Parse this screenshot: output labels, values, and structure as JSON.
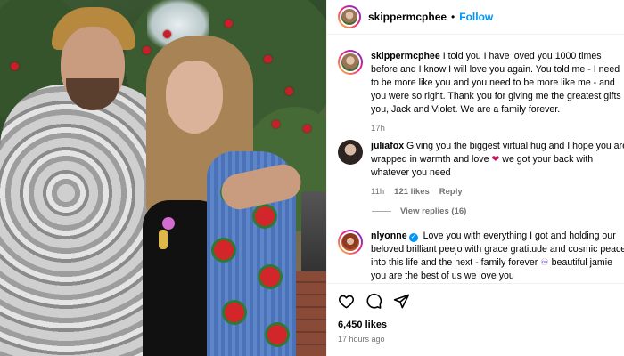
{
  "post": {
    "author": "skippermcphee",
    "follow_label": "Follow",
    "caption_user": "skippermcphee",
    "caption": "I told you I have loved you 1000 times before and I know I will love you again. You told me - I need to be more like you and you need to be more like me - and you were so right. Thank you for giving me the greatest gifts - you, Jack and Violet. We are a family forever.",
    "caption_age": "17h",
    "likes": "6,450 likes",
    "posted": "17 hours ago"
  },
  "comments": [
    {
      "user": "juliafox",
      "text_before": "Giving you the biggest virtual hug and I hope you are wrapped in warmth and love",
      "emoji": "❤",
      "text_after": "we got your back with whatever you need",
      "age": "11h",
      "likes": "121 likes",
      "reply_label": "Reply"
    },
    {
      "user": "nlyonne",
      "text_before": "Love you with everything I got and holding our beloved brilliant peejo with grace gratitude and cosmic peace into this life and the next - family forever",
      "emoji": "♾",
      "text_after": "beautiful jamie you are the best of us we love you"
    }
  ],
  "view_replies": "View replies (16)",
  "icons": [
    "heart-icon",
    "comment-icon",
    "share-icon"
  ],
  "colors": {
    "accent": "#0095f6",
    "muted": "#737373"
  }
}
